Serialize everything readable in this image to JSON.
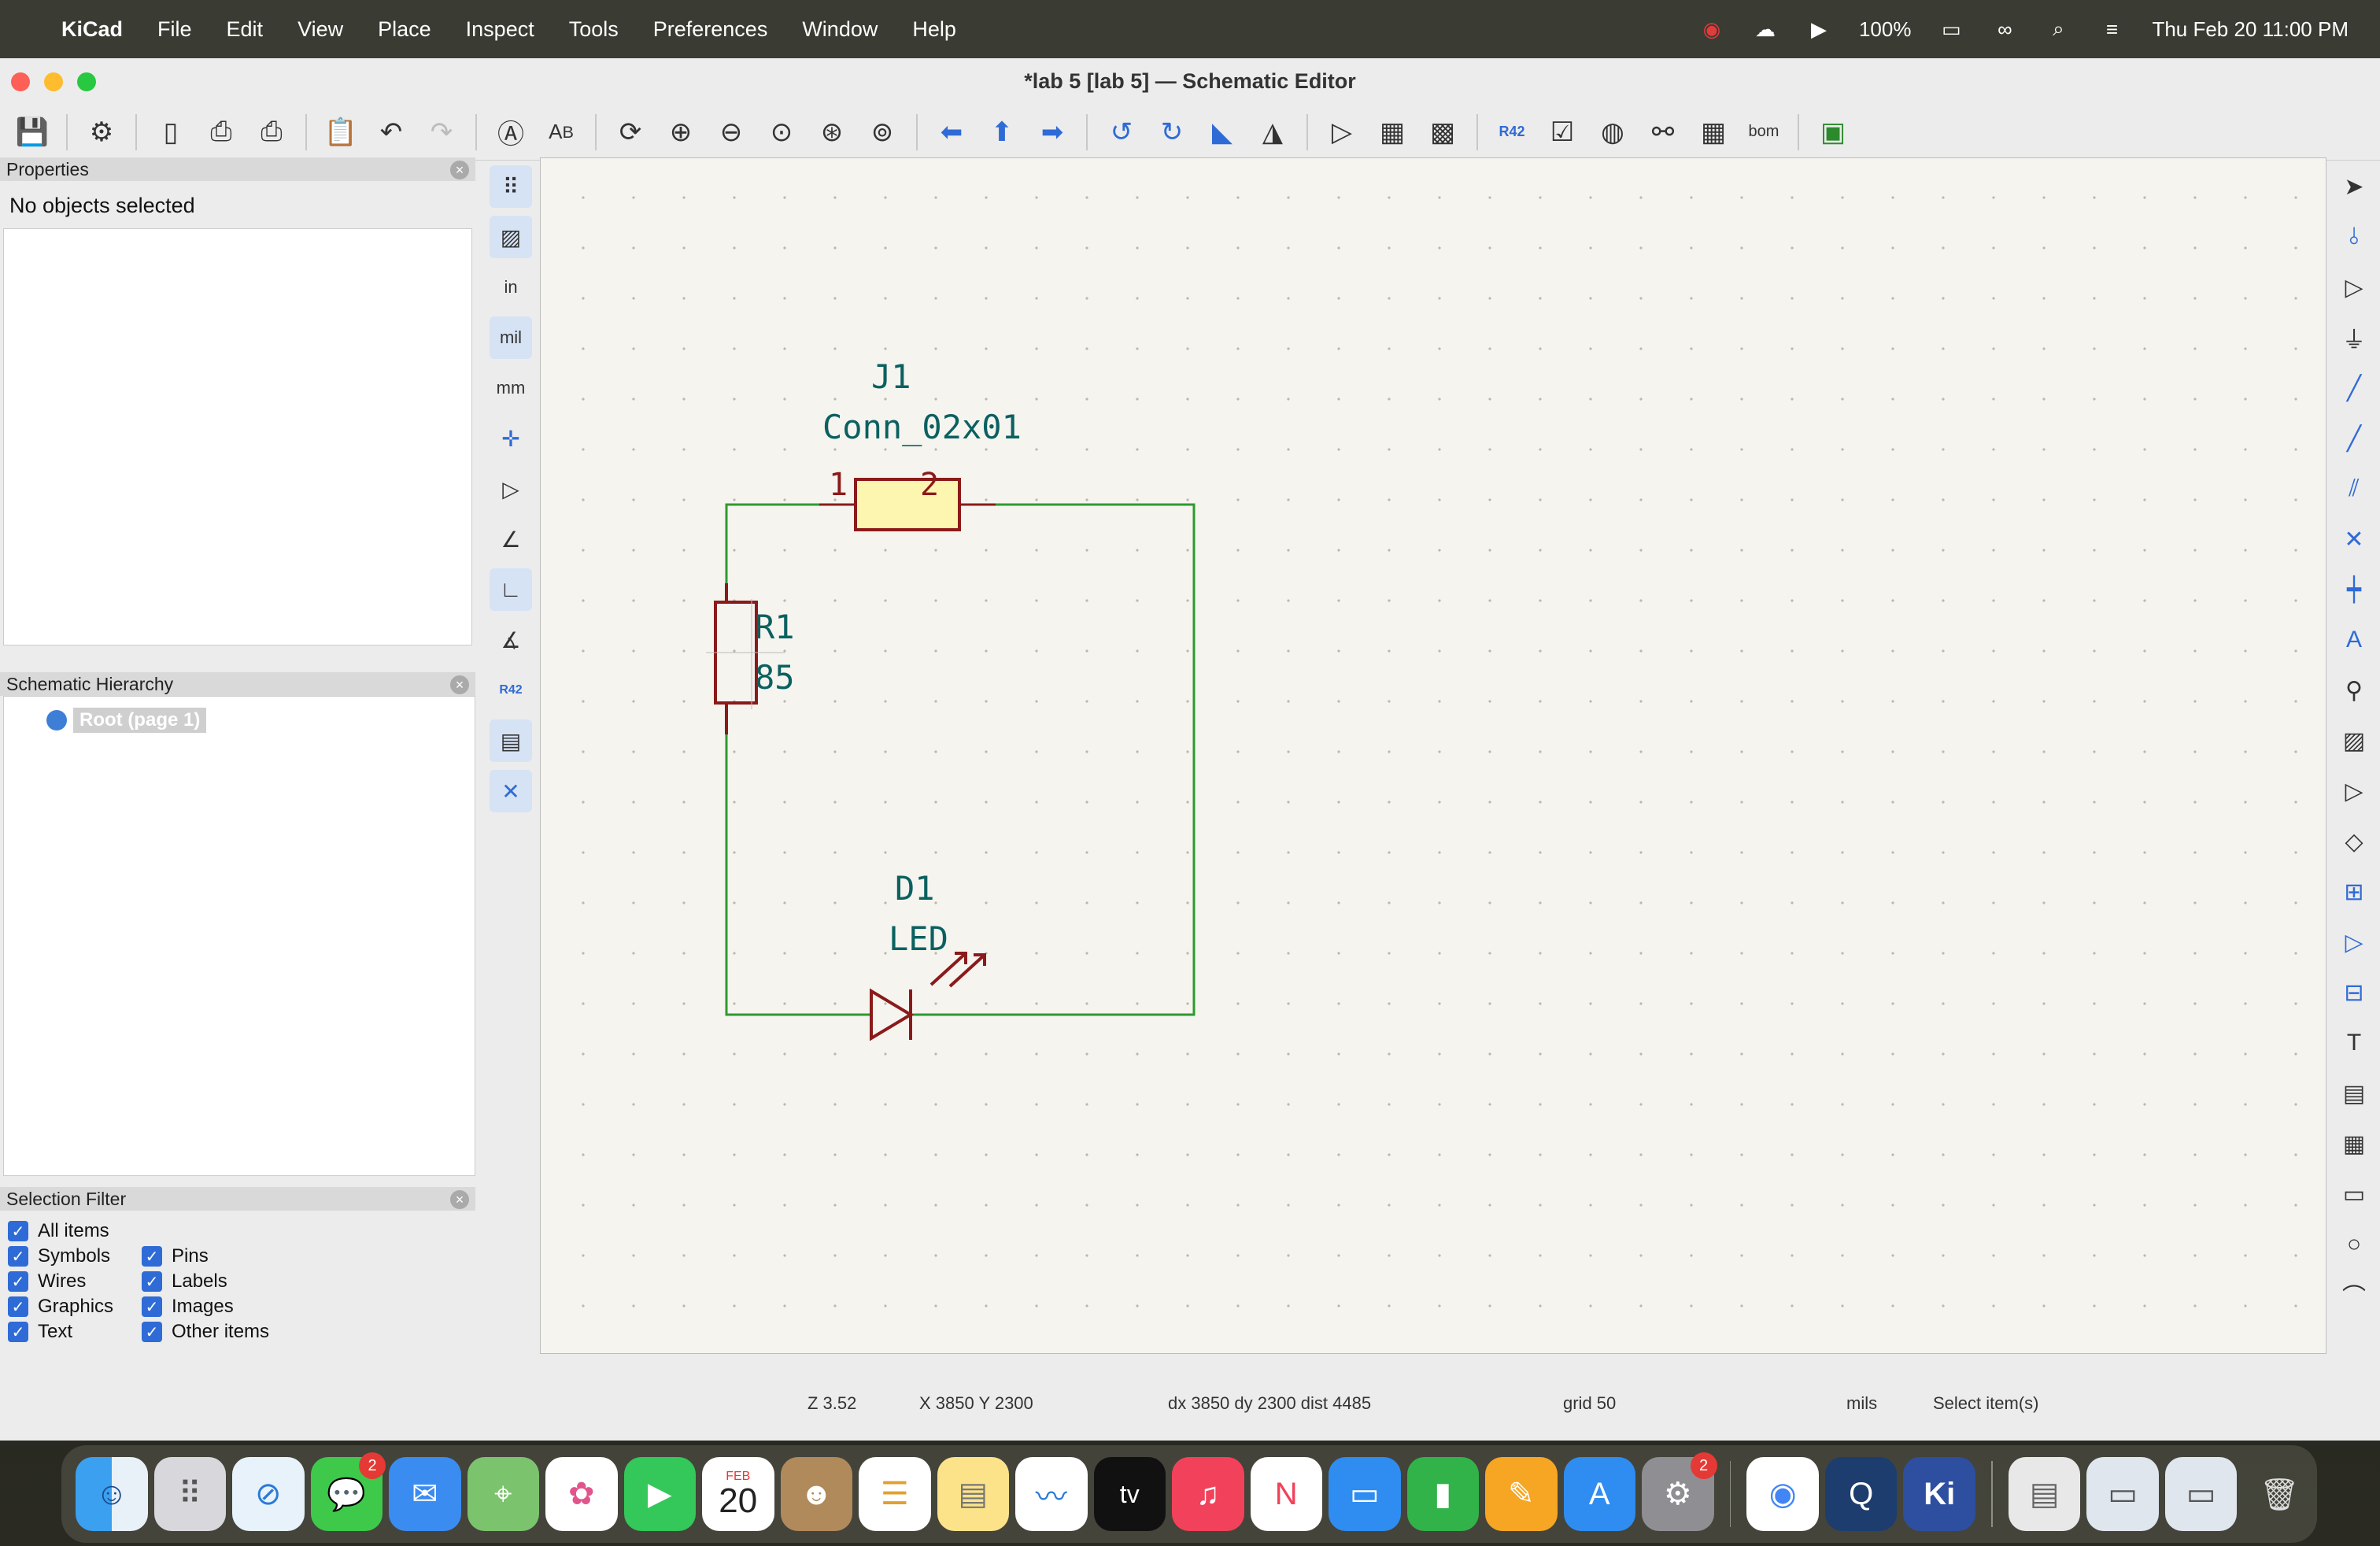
{
  "menubar": {
    "app_name": "KiCad",
    "items": [
      "File",
      "Edit",
      "View",
      "Place",
      "Inspect",
      "Tools",
      "Preferences",
      "Window",
      "Help"
    ],
    "battery": "100%",
    "datetime": "Thu Feb 20  11:00 PM"
  },
  "window": {
    "title": "*lab 5 [lab 5] — Schematic Editor"
  },
  "properties": {
    "title": "Properties",
    "status": "No objects selected"
  },
  "hierarchy": {
    "title": "Schematic Hierarchy",
    "root": "Root (page 1)"
  },
  "selection_filter": {
    "title": "Selection Filter",
    "left": [
      "All items",
      "Symbols",
      "Wires",
      "Graphics",
      "Text"
    ],
    "right": [
      "Pins",
      "Labels",
      "Images",
      "Other items"
    ]
  },
  "schematic": {
    "j1_ref": "J1",
    "j1_value": "Conn_02x01",
    "j1_pin1": "1",
    "j1_pin2": "2",
    "r1_ref": "R1",
    "r1_value": "85",
    "d1_ref": "D1",
    "d1_value": "LED",
    "colors": {
      "wire": "#2e9a2e",
      "symbol": "#8b1a1a",
      "fill": "#fdf6b0",
      "text": "#0b6060"
    }
  },
  "left_toolbar": {
    "in_label": "in",
    "mil_label": "mil",
    "mm_label": "mm",
    "annotate_label": "R??\nR42"
  },
  "statusbar": {
    "zoom": "Z 3.52",
    "coords": "X 3850  Y 2300",
    "delta": "dx 3850  dy 2300  dist 4485",
    "grid": "grid 50",
    "units": "mils",
    "tool": "Select item(s)"
  },
  "dock": {
    "calendar_month": "FEB",
    "calendar_day": "20",
    "messages_badge": "2",
    "settings_badge": "2",
    "appletv_label": "tv",
    "kicad_label": "Ki"
  }
}
